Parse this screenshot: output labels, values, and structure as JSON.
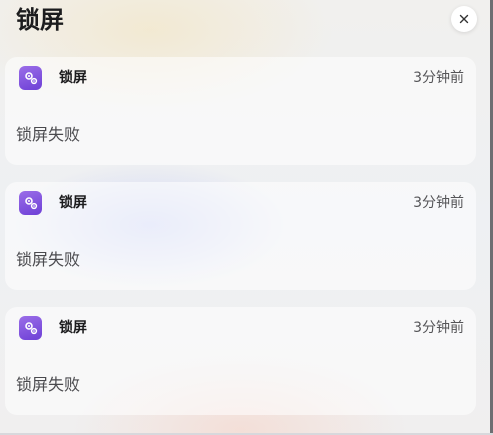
{
  "panel": {
    "title": "锁屏",
    "close_icon": "close-icon"
  },
  "notifications": [
    {
      "app_name": "锁屏",
      "time": "3分钟前",
      "message": "锁屏失败",
      "icon": "settings-gears-icon"
    },
    {
      "app_name": "锁屏",
      "time": "3分钟前",
      "message": "锁屏失败",
      "icon": "settings-gears-icon"
    },
    {
      "app_name": "锁屏",
      "time": "3分钟前",
      "message": "锁屏失败",
      "icon": "settings-gears-icon"
    }
  ],
  "colors": {
    "app_icon": "#7c4ddc",
    "title_text": "#1c1c1e",
    "secondary_text": "#555558"
  }
}
